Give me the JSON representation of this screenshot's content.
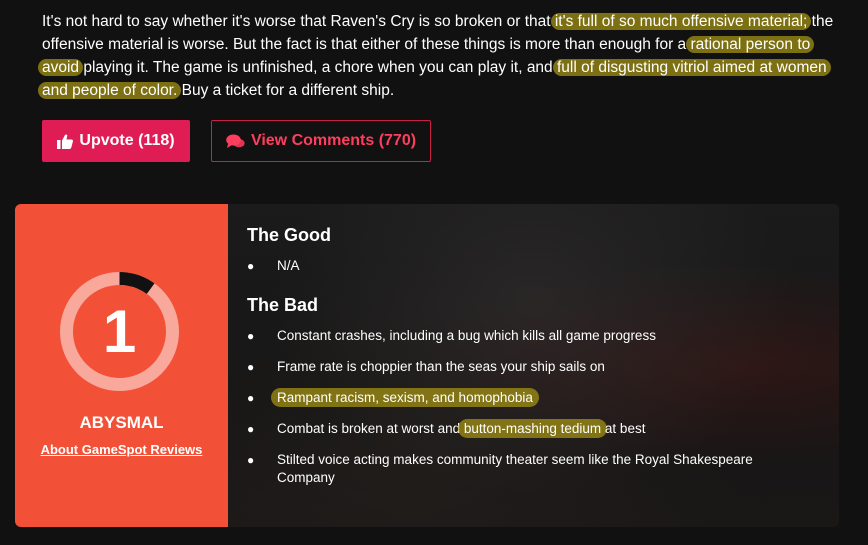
{
  "article": {
    "seg1": "It's not hard to say whether it's worse that Raven's Cry is so broken or that ",
    "seg2_hl": "it's full of so much offensive material;",
    "seg3": " the offensive material is worse. But the fact is that either of these things is more than enough for a ",
    "seg4_hl": "rational person to avoid",
    "seg5": " playing it. The game is unfinished, a chore when you can play it, and ",
    "seg6_hl": "full of disgusting vitriol aimed at women and people of color.",
    "seg7": " Buy a ticket for a different ship."
  },
  "actions": {
    "upvote_label": "Upvote (118)",
    "view_comments_label": "View Comments (770)"
  },
  "score": {
    "value": "1",
    "fraction": 0.1,
    "verdict": "ABYSMAL",
    "about_link": "About GameSpot Reviews"
  },
  "good": {
    "title": "The Good",
    "items": [
      "N/A"
    ]
  },
  "bad": {
    "title": "The Bad",
    "items": [
      "Constant crashes, including a bug which kills all game progress",
      "Frame rate is choppier than the seas your ship sails on",
      "Rampant racism, sexism, and homophobia",
      "Combat is broken at worst and ",
      "button-mashing tedium",
      " at best",
      "Stilted voice acting makes community theater seem like the Royal Shakespeare Company"
    ]
  },
  "icons": {
    "upvote": "thumbs-up-icon",
    "comments": "comments-icon"
  },
  "colors": {
    "background": "#111111",
    "score_panel": "#f25138",
    "upvote_button": "#e01c55",
    "view_comments_text": "#ff3e5e",
    "highlight": "#a89614"
  }
}
